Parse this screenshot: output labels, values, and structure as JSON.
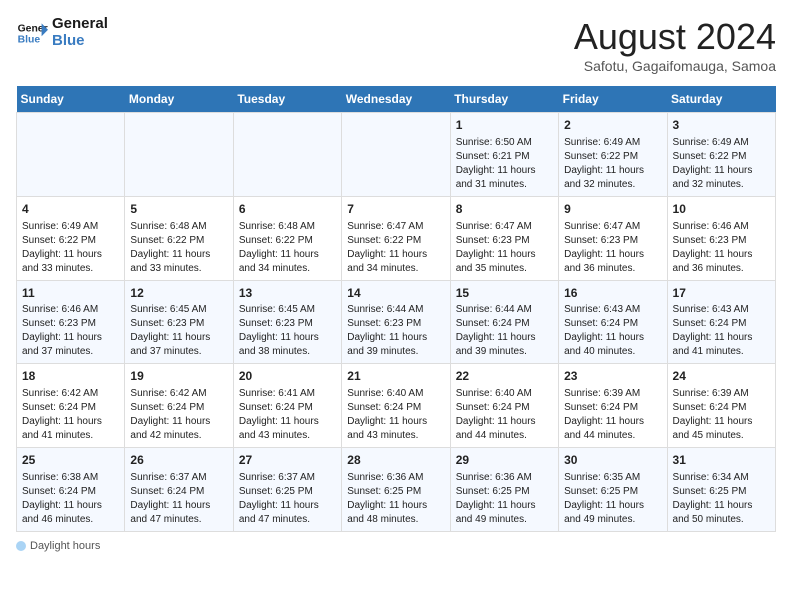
{
  "logo": {
    "line1": "General",
    "line2": "Blue"
  },
  "title": "August 2024",
  "subtitle": "Safotu, Gagaifomauga, Samoa",
  "days_of_week": [
    "Sunday",
    "Monday",
    "Tuesday",
    "Wednesday",
    "Thursday",
    "Friday",
    "Saturday"
  ],
  "weeks": [
    [
      {
        "day": "",
        "info": ""
      },
      {
        "day": "",
        "info": ""
      },
      {
        "day": "",
        "info": ""
      },
      {
        "day": "",
        "info": ""
      },
      {
        "day": "1",
        "info": "Sunrise: 6:50 AM\nSunset: 6:21 PM\nDaylight: 11 hours and 31 minutes."
      },
      {
        "day": "2",
        "info": "Sunrise: 6:49 AM\nSunset: 6:22 PM\nDaylight: 11 hours and 32 minutes."
      },
      {
        "day": "3",
        "info": "Sunrise: 6:49 AM\nSunset: 6:22 PM\nDaylight: 11 hours and 32 minutes."
      }
    ],
    [
      {
        "day": "4",
        "info": "Sunrise: 6:49 AM\nSunset: 6:22 PM\nDaylight: 11 hours and 33 minutes."
      },
      {
        "day": "5",
        "info": "Sunrise: 6:48 AM\nSunset: 6:22 PM\nDaylight: 11 hours and 33 minutes."
      },
      {
        "day": "6",
        "info": "Sunrise: 6:48 AM\nSunset: 6:22 PM\nDaylight: 11 hours and 34 minutes."
      },
      {
        "day": "7",
        "info": "Sunrise: 6:47 AM\nSunset: 6:22 PM\nDaylight: 11 hours and 34 minutes."
      },
      {
        "day": "8",
        "info": "Sunrise: 6:47 AM\nSunset: 6:23 PM\nDaylight: 11 hours and 35 minutes."
      },
      {
        "day": "9",
        "info": "Sunrise: 6:47 AM\nSunset: 6:23 PM\nDaylight: 11 hours and 36 minutes."
      },
      {
        "day": "10",
        "info": "Sunrise: 6:46 AM\nSunset: 6:23 PM\nDaylight: 11 hours and 36 minutes."
      }
    ],
    [
      {
        "day": "11",
        "info": "Sunrise: 6:46 AM\nSunset: 6:23 PM\nDaylight: 11 hours and 37 minutes."
      },
      {
        "day": "12",
        "info": "Sunrise: 6:45 AM\nSunset: 6:23 PM\nDaylight: 11 hours and 37 minutes."
      },
      {
        "day": "13",
        "info": "Sunrise: 6:45 AM\nSunset: 6:23 PM\nDaylight: 11 hours and 38 minutes."
      },
      {
        "day": "14",
        "info": "Sunrise: 6:44 AM\nSunset: 6:23 PM\nDaylight: 11 hours and 39 minutes."
      },
      {
        "day": "15",
        "info": "Sunrise: 6:44 AM\nSunset: 6:24 PM\nDaylight: 11 hours and 39 minutes."
      },
      {
        "day": "16",
        "info": "Sunrise: 6:43 AM\nSunset: 6:24 PM\nDaylight: 11 hours and 40 minutes."
      },
      {
        "day": "17",
        "info": "Sunrise: 6:43 AM\nSunset: 6:24 PM\nDaylight: 11 hours and 41 minutes."
      }
    ],
    [
      {
        "day": "18",
        "info": "Sunrise: 6:42 AM\nSunset: 6:24 PM\nDaylight: 11 hours and 41 minutes."
      },
      {
        "day": "19",
        "info": "Sunrise: 6:42 AM\nSunset: 6:24 PM\nDaylight: 11 hours and 42 minutes."
      },
      {
        "day": "20",
        "info": "Sunrise: 6:41 AM\nSunset: 6:24 PM\nDaylight: 11 hours and 43 minutes."
      },
      {
        "day": "21",
        "info": "Sunrise: 6:40 AM\nSunset: 6:24 PM\nDaylight: 11 hours and 43 minutes."
      },
      {
        "day": "22",
        "info": "Sunrise: 6:40 AM\nSunset: 6:24 PM\nDaylight: 11 hours and 44 minutes."
      },
      {
        "day": "23",
        "info": "Sunrise: 6:39 AM\nSunset: 6:24 PM\nDaylight: 11 hours and 44 minutes."
      },
      {
        "day": "24",
        "info": "Sunrise: 6:39 AM\nSunset: 6:24 PM\nDaylight: 11 hours and 45 minutes."
      }
    ],
    [
      {
        "day": "25",
        "info": "Sunrise: 6:38 AM\nSunset: 6:24 PM\nDaylight: 11 hours and 46 minutes."
      },
      {
        "day": "26",
        "info": "Sunrise: 6:37 AM\nSunset: 6:24 PM\nDaylight: 11 hours and 47 minutes."
      },
      {
        "day": "27",
        "info": "Sunrise: 6:37 AM\nSunset: 6:25 PM\nDaylight: 11 hours and 47 minutes."
      },
      {
        "day": "28",
        "info": "Sunrise: 6:36 AM\nSunset: 6:25 PM\nDaylight: 11 hours and 48 minutes."
      },
      {
        "day": "29",
        "info": "Sunrise: 6:36 AM\nSunset: 6:25 PM\nDaylight: 11 hours and 49 minutes."
      },
      {
        "day": "30",
        "info": "Sunrise: 6:35 AM\nSunset: 6:25 PM\nDaylight: 11 hours and 49 minutes."
      },
      {
        "day": "31",
        "info": "Sunrise: 6:34 AM\nSunset: 6:25 PM\nDaylight: 11 hours and 50 minutes."
      }
    ]
  ],
  "footer": {
    "daylight_label": "Daylight hours"
  }
}
